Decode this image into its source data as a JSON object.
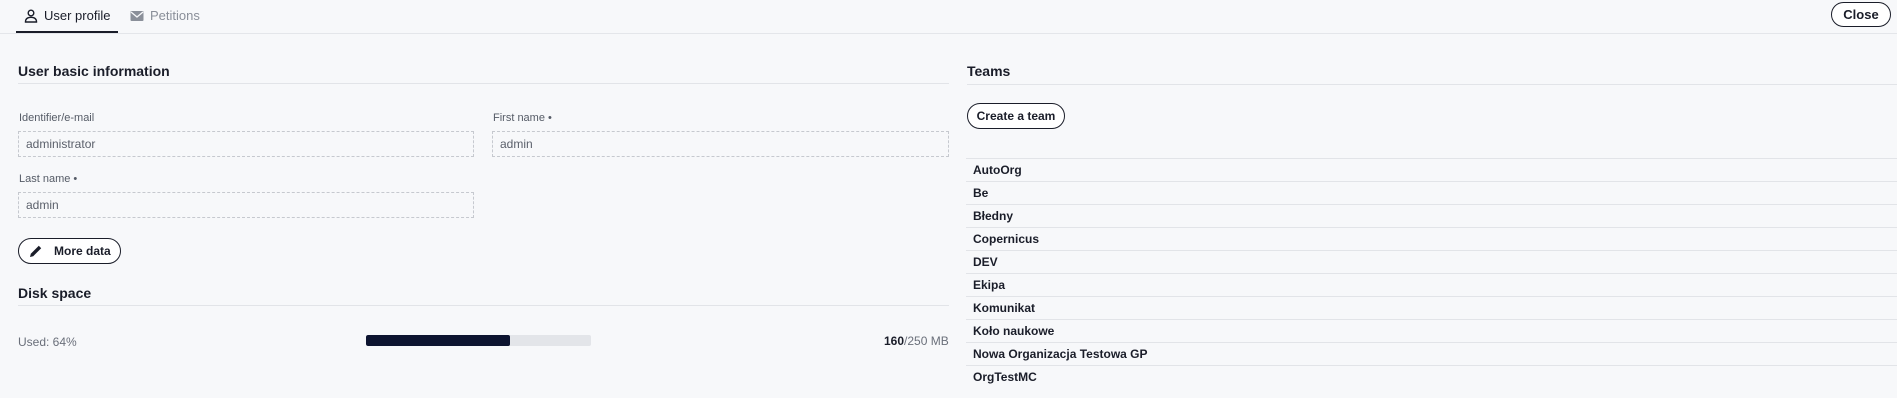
{
  "tabs": [
    {
      "label": "User profile",
      "icon": "user-icon",
      "active": true
    },
    {
      "label": "Petitions",
      "icon": "envelope-icon",
      "active": false
    }
  ],
  "close_label": "Close",
  "basic_info": {
    "title": "User basic information",
    "identifier_label": "Identifier/e-mail",
    "identifier_value": "administrator",
    "first_name_label": "First name •",
    "first_name_value": "admin",
    "last_name_label": "Last name •",
    "last_name_value": "admin",
    "more_data_label": "More data",
    "more_data_icon": "pencil-icon"
  },
  "disk_space": {
    "title": "Disk space",
    "used_label": "Used: 64%",
    "used_fraction": 0.64,
    "used_mb": "160",
    "total": "/250 MB"
  },
  "teams": {
    "title": "Teams",
    "create_label": "Create a team",
    "items": [
      "AutoOrg",
      "Be",
      "Błedny",
      "Copernicus",
      "DEV",
      "Ekipa",
      "Komunikat",
      "Koło naukowe",
      "Nowa Organizacja Testowa GP",
      "OrgTestMC"
    ]
  },
  "colors": {
    "progress_fill": "#0d1430",
    "progress_track": "#e3e5e9",
    "background": "#f7f8fa"
  }
}
